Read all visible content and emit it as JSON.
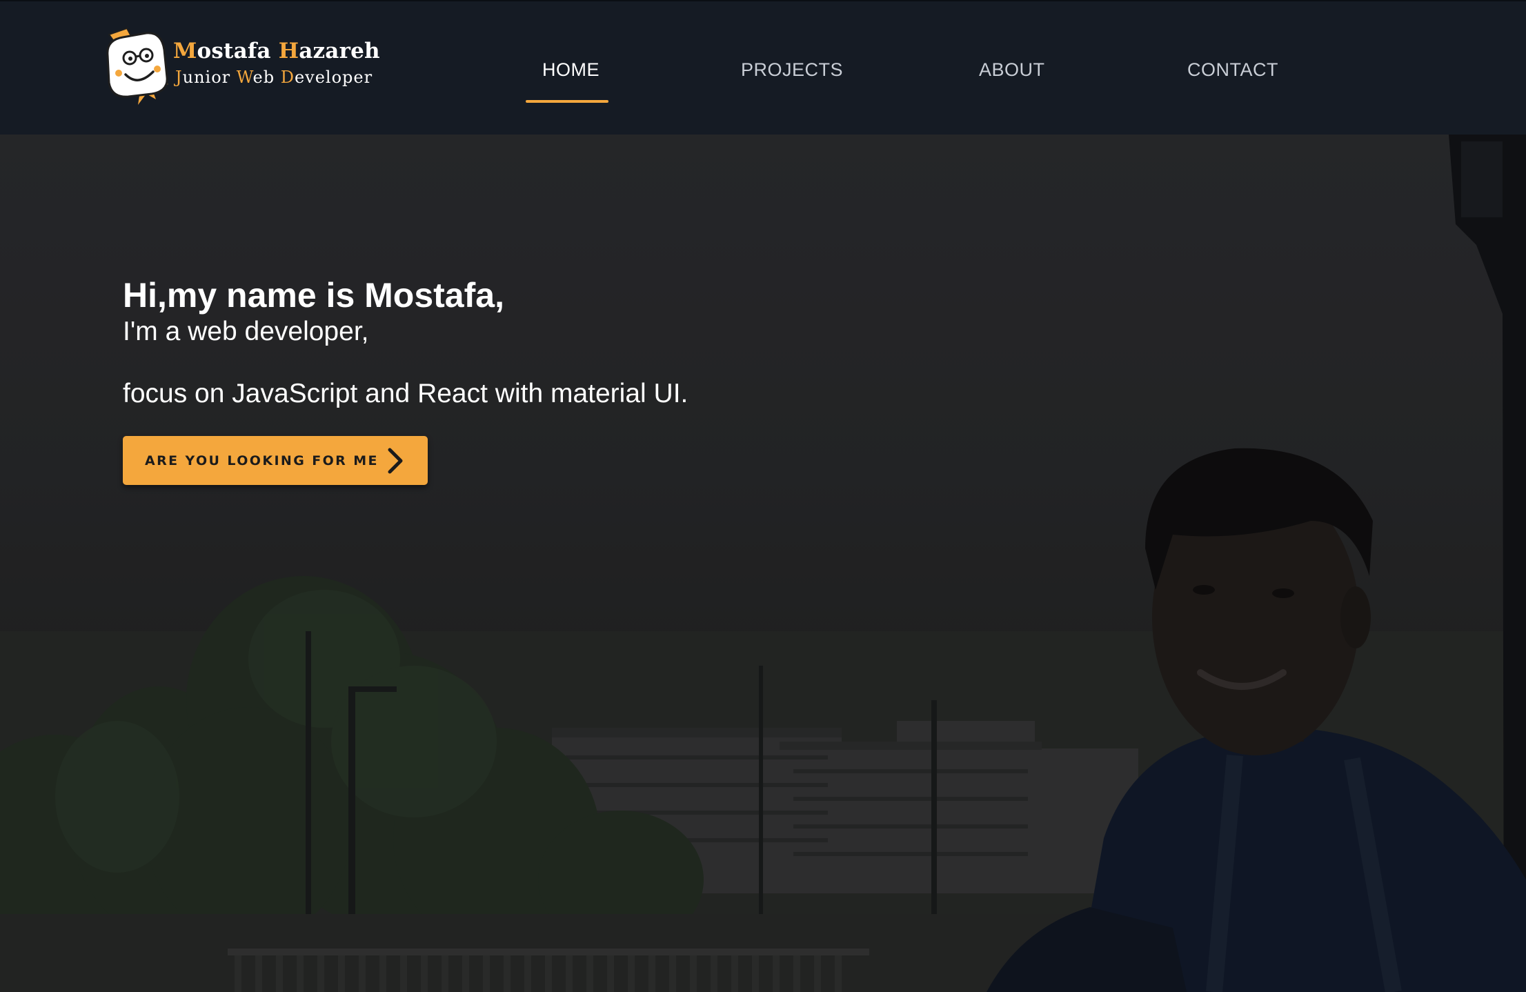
{
  "brand": {
    "name_first_initial": "M",
    "name_first_rest": "ostafa",
    "name_last_initial": "H",
    "name_last_rest": "azareh",
    "role_w1_initial": "J",
    "role_w1_rest": "unior",
    "role_w2_initial": "W",
    "role_w2_rest": "eb",
    "role_w3_initial": "D",
    "role_w3_rest": "eveloper",
    "logo_icon": "smiley-mascot-icon"
  },
  "nav": {
    "items": [
      {
        "label": "HOME",
        "active": true
      },
      {
        "label": "PROJECTS",
        "active": false
      },
      {
        "label": "ABOUT",
        "active": false
      },
      {
        "label": "CONTACT",
        "active": false
      }
    ]
  },
  "hero": {
    "greeting": "Hi,my name is Mostafa,",
    "intro": "I'm a web developer,",
    "focus": "focus on JavaScript and React with material UI.",
    "cta_label": "ARE YOU LOOKING FOR ME",
    "cta_icon": "chevron-right-icon"
  },
  "colors": {
    "accent": "#f4a73d",
    "navbar_bg": "#151b24",
    "text": "#ffffff",
    "nav_text": "#c9ced6"
  }
}
